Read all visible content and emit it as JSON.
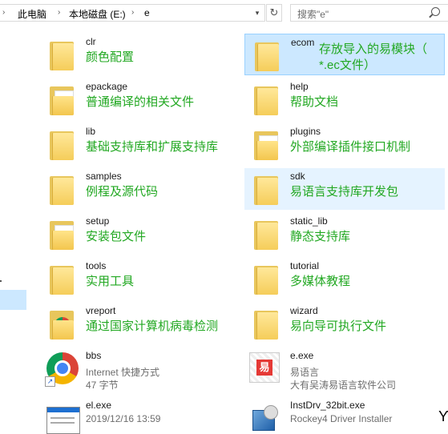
{
  "breadcrumb": [
    "此电脑",
    "本地磁盘 (E:)",
    "e"
  ],
  "search": {
    "placeholder": "搜索\"e\""
  },
  "items": [
    {
      "name": "clr",
      "desc": "颜色配置",
      "kind": "folder"
    },
    {
      "name": "ecom",
      "desc": "存放导入的易模块（",
      "desc2": "*.ec文件）",
      "kind": "folder"
    },
    {
      "name": "epackage",
      "desc": "普通编译的相关文件",
      "kind": "folder-paper"
    },
    {
      "name": "help",
      "desc": "帮助文档",
      "kind": "folder"
    },
    {
      "name": "lib",
      "desc": "基础支持库和扩展支持库",
      "kind": "folder"
    },
    {
      "name": "plugins",
      "desc": "外部编译插件接口机制",
      "kind": "folder-paper"
    },
    {
      "name": "samples",
      "desc": "例程及源代码",
      "kind": "folder"
    },
    {
      "name": "sdk",
      "desc": "易语言支持库开发包",
      "kind": "folder"
    },
    {
      "name": "setup",
      "desc": "安装包文件",
      "kind": "folder-paper"
    },
    {
      "name": "static_lib",
      "desc": "静态支持库",
      "kind": "folder"
    },
    {
      "name": "tools",
      "desc": "实用工具",
      "kind": "folder"
    },
    {
      "name": "tutorial",
      "desc": "多媒体教程",
      "kind": "folder"
    },
    {
      "name": "vreport",
      "desc": "通过国家计算机病毒检测",
      "kind": "folder-chrome"
    },
    {
      "name": "wizard",
      "desc": "易向导可执行文件",
      "kind": "folder"
    }
  ],
  "files": [
    {
      "name": "bbs",
      "line1": "Internet 快捷方式",
      "line2": "47 字节",
      "icon": "chrome-shortcut-icon"
    },
    {
      "name": "e.exe",
      "line1": "易语言",
      "line2": "大有吴涛易语言软件公司",
      "icon": "e-language-icon"
    },
    {
      "name": "el.exe",
      "line1": "2019/12/16 13:59",
      "icon": "window-exe-icon"
    },
    {
      "name": "InstDrv_32bit.exe",
      "line1": "Rockey4 Driver Installer",
      "icon": "installer-icon"
    }
  ]
}
